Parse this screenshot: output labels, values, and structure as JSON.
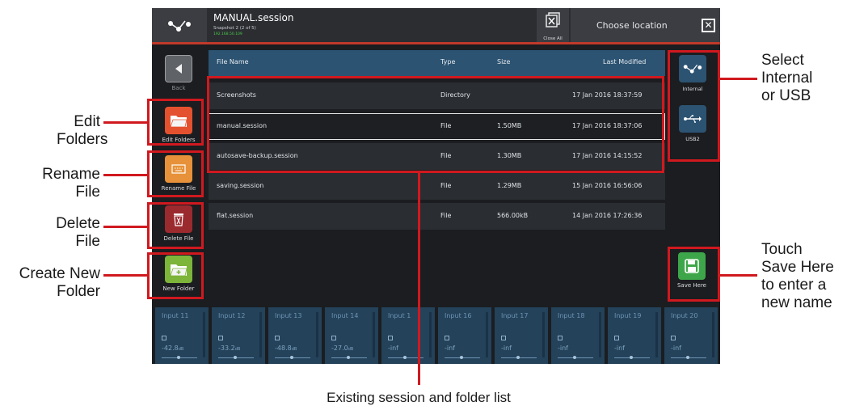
{
  "app": {
    "session_title": "MANUAL.session",
    "snapshot": "Snapshot 2 (2 of 5)",
    "ip": "192.168.50.109",
    "close_all": "Close All",
    "choose_location": "Choose location"
  },
  "sidebar": {
    "back": "Back",
    "edit_folders": "Edit Folders",
    "rename_file": "Rename File",
    "delete_file": "Delete File",
    "new_folder": "New Folder"
  },
  "table": {
    "headers": [
      "File Name",
      "Type",
      "Size",
      "Last Modified"
    ],
    "rows": [
      {
        "name": "Screenshots",
        "type": "Directory",
        "size": "",
        "modified": "17 Jan 2016 18:37:59"
      },
      {
        "name": "manual.session",
        "type": "File",
        "size": "1.50MB",
        "modified": "17 Jan 2016 18:37:06"
      },
      {
        "name": "autosave-backup.session",
        "type": "File",
        "size": "1.30MB",
        "modified": "17 Jan 2016 14:15:52"
      },
      {
        "name": "saving.session",
        "type": "File",
        "size": "1.29MB",
        "modified": "15 Jan 2016 16:56:06"
      },
      {
        "name": "flat.session",
        "type": "File",
        "size": "566.00kB",
        "modified": "14 Jan 2016 17:26:36"
      }
    ]
  },
  "locations": {
    "internal": "Internal",
    "usb": "USB2",
    "save_here": "Save Here"
  },
  "inputs": [
    {
      "name": "Input 11",
      "value": "-42.8",
      "unit": "dB"
    },
    {
      "name": "Input 12",
      "value": "-33.2",
      "unit": "dB"
    },
    {
      "name": "Input 13",
      "value": "-48.8",
      "unit": "dB"
    },
    {
      "name": "Input 14",
      "value": "-27.0",
      "unit": "dB"
    },
    {
      "name": "Input 1",
      "value": "-inf",
      "unit": ""
    },
    {
      "name": "Input 16",
      "value": "-inf",
      "unit": ""
    },
    {
      "name": "Input 17",
      "value": "-inf",
      "unit": ""
    },
    {
      "name": "Input 18",
      "value": "-inf",
      "unit": ""
    },
    {
      "name": "Input 19",
      "value": "-inf",
      "unit": ""
    },
    {
      "name": "Input 20",
      "value": "-inf",
      "unit": ""
    }
  ],
  "annotations": {
    "edit_folders": "Edit\nFolders",
    "rename_file": "Rename\nFile",
    "delete_file": "Delete\nFile",
    "create_folder": "Create New\nFolder",
    "select_location": "Select\nInternal\nor USB",
    "save_here": "Touch\nSave Here\nto enter a\nnew name",
    "list": "Existing session and folder list"
  },
  "colors": {
    "accent_blue": "#2c5372",
    "annotation_red": "#d0191f",
    "edit_folder_icon": "#e4512f",
    "rename_icon": "#e7923a",
    "delete_icon": "#9b2a2f",
    "new_folder_icon": "#7db43a",
    "save_icon": "#3ea64a"
  }
}
